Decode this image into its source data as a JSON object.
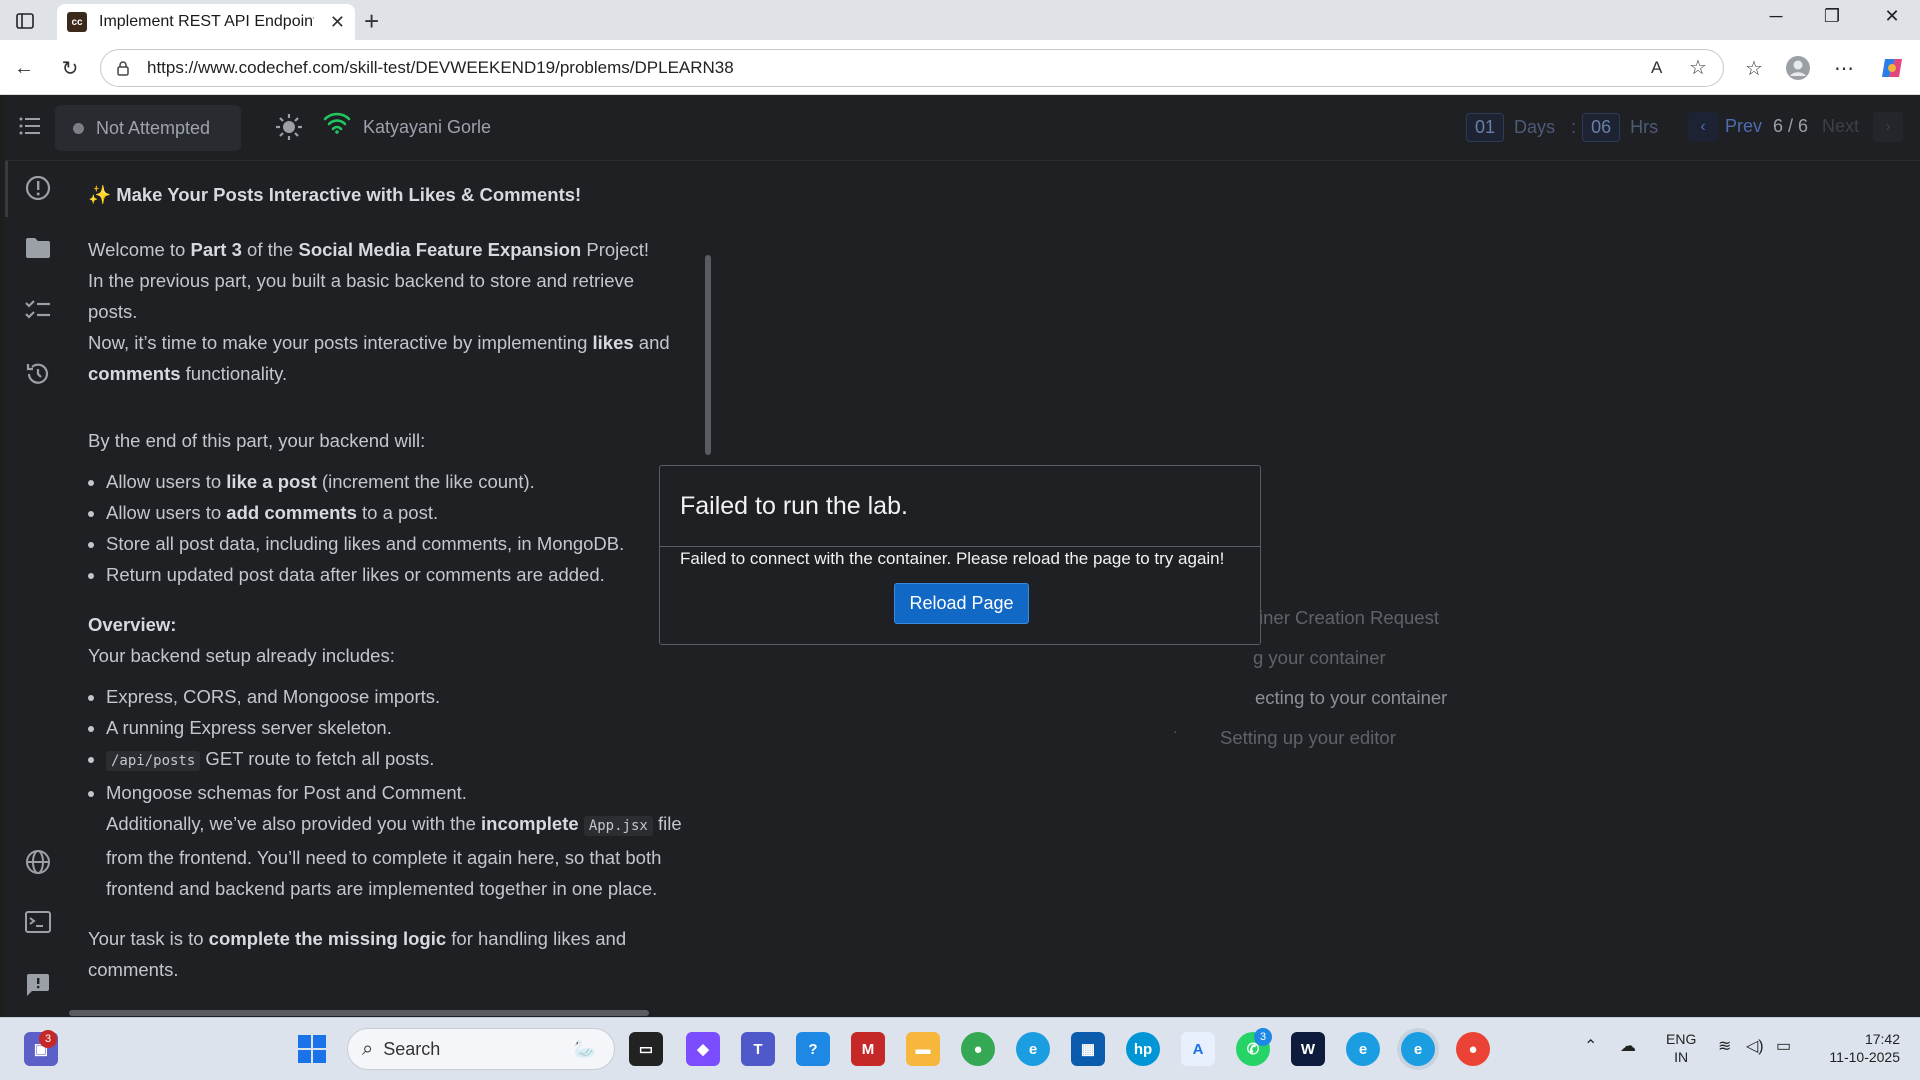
{
  "browser": {
    "tab_title": "Implement REST API Endpoints fo",
    "favicon_text": "cc",
    "url": "https://www.codechef.com/skill-test/DEVWEEKEND19/problems/DPLEARN38"
  },
  "topbar": {
    "status": "Not Attempted",
    "user_name": "Katyayani Gorle",
    "days_value": "01",
    "days_label": "Days",
    "colon": ":",
    "hrs_value": "06",
    "hrs_label": "Hrs",
    "prev_label": "Prev",
    "page_indicator": "6 / 6",
    "next_label": "Next"
  },
  "problem": {
    "heading": "Make Your Posts Interactive with Likes & Comments!",
    "heading_emoji": "✨",
    "intro_1": "Welcome to ",
    "intro_part": "Part 3",
    "intro_2": " of the ",
    "intro_project": "Social Media Feature Expansion",
    "intro_3": " Project!",
    "intro_line2": "In the previous part, you built a basic backend to store and retrieve posts.",
    "intro_line3a": "Now, it’s time to make your posts interactive by implementing ",
    "intro_likes": "likes",
    "intro_and": " and ",
    "intro_comments": "comments",
    "intro_line3b": " functionality.",
    "end_intro": "By the end of this part, your backend will:",
    "goal1a": "Allow users to ",
    "goal1b": "like a post",
    "goal1c": " (increment the like count).",
    "goal2a": "Allow users to ",
    "goal2b": "add comments",
    "goal2c": " to a post.",
    "goal3": "Store all post data, including likes and comments, in MongoDB.",
    "goal4": "Return updated post data after likes or comments are added.",
    "overview_title": "Overview:",
    "overview_intro": "Your backend setup already includes:",
    "inc1": "Express, CORS, and Mongoose imports.",
    "inc2": "A running Express server skeleton.",
    "inc3_code": "/api/posts",
    "inc3_text": " GET route to fetch all posts.",
    "inc4": "Mongoose schemas for Post and Comment.",
    "inc4b_1": "Additionally, we’ve also provided you with the ",
    "inc4b_bold": "incomplete",
    "inc4b_code": "App.jsx",
    "inc4b_2": " file",
    "inc4b_3": "from the frontend. You’ll need to complete it again here, so that both",
    "inc4b_4": "frontend and backend parts are implemented together in one place.",
    "task_1": "Your task is to ",
    "task_bold": "complete the missing logic",
    "task_2": " for handling likes and",
    "task_3": "comments."
  },
  "lab_steps": [
    "Container Creation Request",
    "Starting your container",
    "Connecting to your container",
    "Setting up your editor"
  ],
  "lab_steps_visible": [
    "iner Creation Request",
    "g your container",
    "ecting to your container",
    "Setting up your editor"
  ],
  "modal": {
    "title": "Failed to run the lab.",
    "message": "Failed to connect with the container. Please reload the page to try again!",
    "button": "Reload Page"
  },
  "taskbar": {
    "search_placeholder": "Search",
    "lang_top": "ENG",
    "lang_bottom": "IN",
    "time": "17:42",
    "date": "11-10-2025",
    "badge_left": "3",
    "badge_whatsapp": "3"
  },
  "colors": {
    "accent_blue": "#1168c5",
    "app_bg": "#1f2023",
    "wifi_green": "#22c55e"
  }
}
